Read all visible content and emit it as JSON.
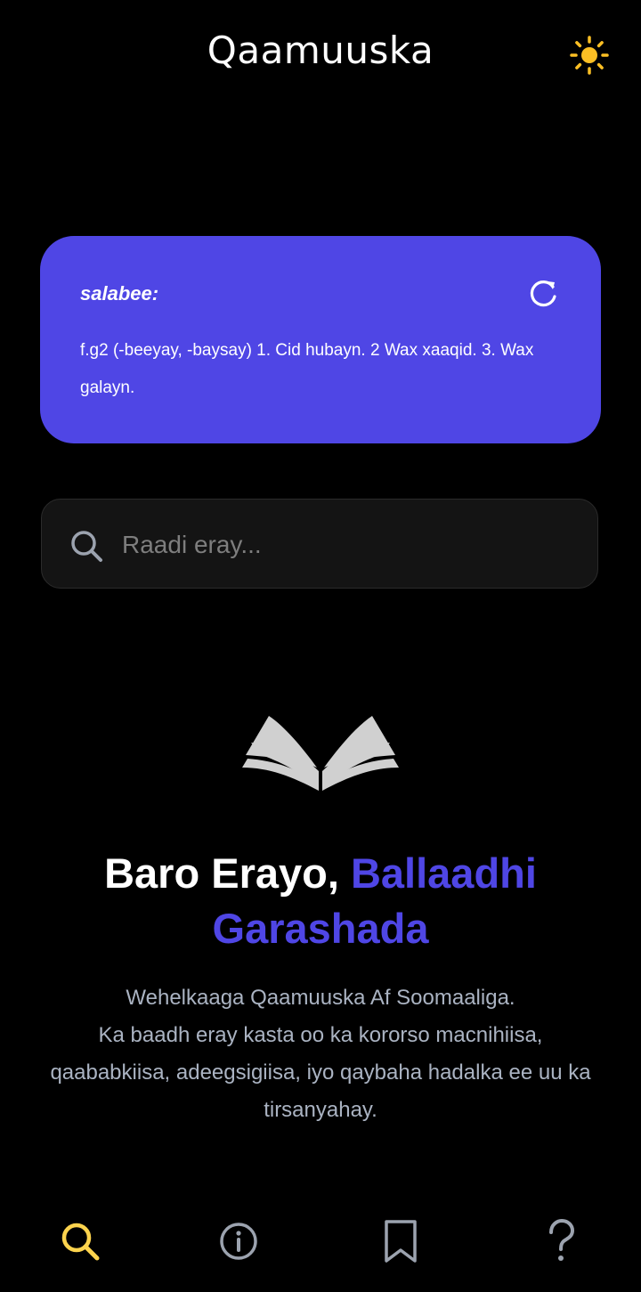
{
  "header": {
    "title": "Qaamuuska",
    "theme_icon": "sun-icon"
  },
  "word_of_day": {
    "word": "salabee:",
    "definition": "f.g2 (-beeyay, -baysay) 1. Cid hubayn. 2 Wax xaaqid. 3. Wax galayn.",
    "refresh_icon": "refresh-icon"
  },
  "search": {
    "placeholder": "Raadi eray...",
    "value": "",
    "icon": "search-icon"
  },
  "hero": {
    "icon": "open-book-icon",
    "headline_part1": "Baro Erayo, ",
    "headline_part2": "Ballaadhi Garashada",
    "tagline_line1": "Wehelkaaga Qaamuuska Af Soomaaliga.",
    "tagline_line2": "Ka baadh eray kasta oo ka kororso macnihiisa, qaababkiisa, adeegsigiisa, iyo qaybaha hadalka ee uu ka tirsanyahay."
  },
  "nav": {
    "items": [
      {
        "icon": "search-icon",
        "active": true
      },
      {
        "icon": "info-icon",
        "active": false
      },
      {
        "icon": "bookmark-icon",
        "active": false
      },
      {
        "icon": "help-icon",
        "active": false
      }
    ]
  },
  "colors": {
    "background": "#000000",
    "accent": "#4f46e5",
    "sun": "#fbbf24",
    "active_nav": "#fcd34d",
    "inactive_nav": "#9ca3af",
    "tagline": "#aab3c2"
  }
}
